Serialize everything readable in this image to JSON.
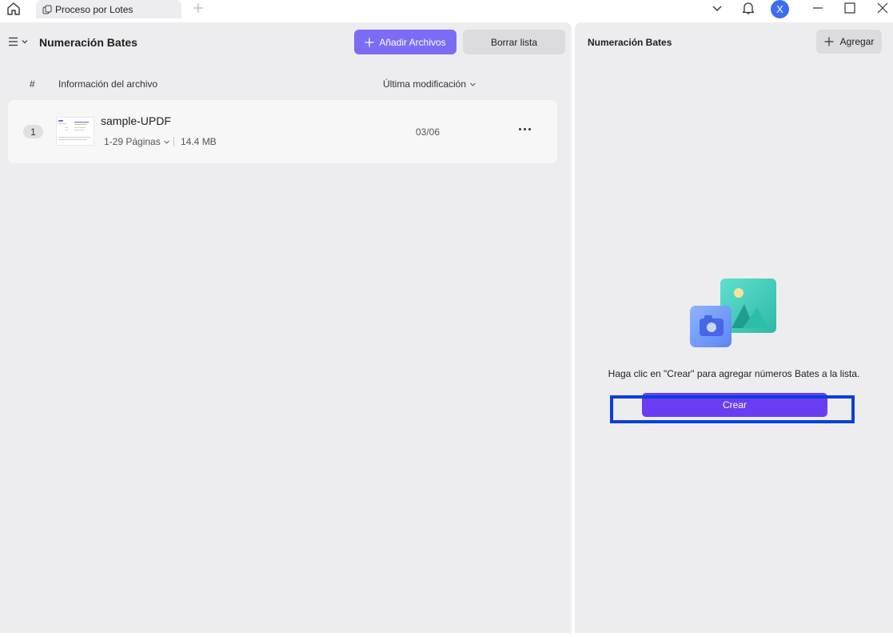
{
  "titlebar": {
    "tab_label": "Proceso por Lotes",
    "avatar_initial": "X"
  },
  "left": {
    "title": "Numeración Bates",
    "add_files_label": "Añadir Archivos",
    "clear_list_label": "Borrar lista",
    "columns": {
      "index": "#",
      "info": "Información del archivo",
      "modified": "Última modificación"
    },
    "files": [
      {
        "index": "1",
        "name": "sample-UPDF",
        "pages": "1-29 Páginas",
        "size": "14.4 MB",
        "modified": "03/06"
      }
    ]
  },
  "right": {
    "title": "Numeración Bates",
    "add_label": "Agregar",
    "empty_hint": "Haga clic en \"Crear\" para agregar números Bates a la lista.",
    "create_label": "Crear"
  },
  "colors": {
    "accent": "#7b6cf6",
    "create": "#6a3df2",
    "highlight": "#0b3fdc",
    "panel_bg": "#ededef"
  }
}
